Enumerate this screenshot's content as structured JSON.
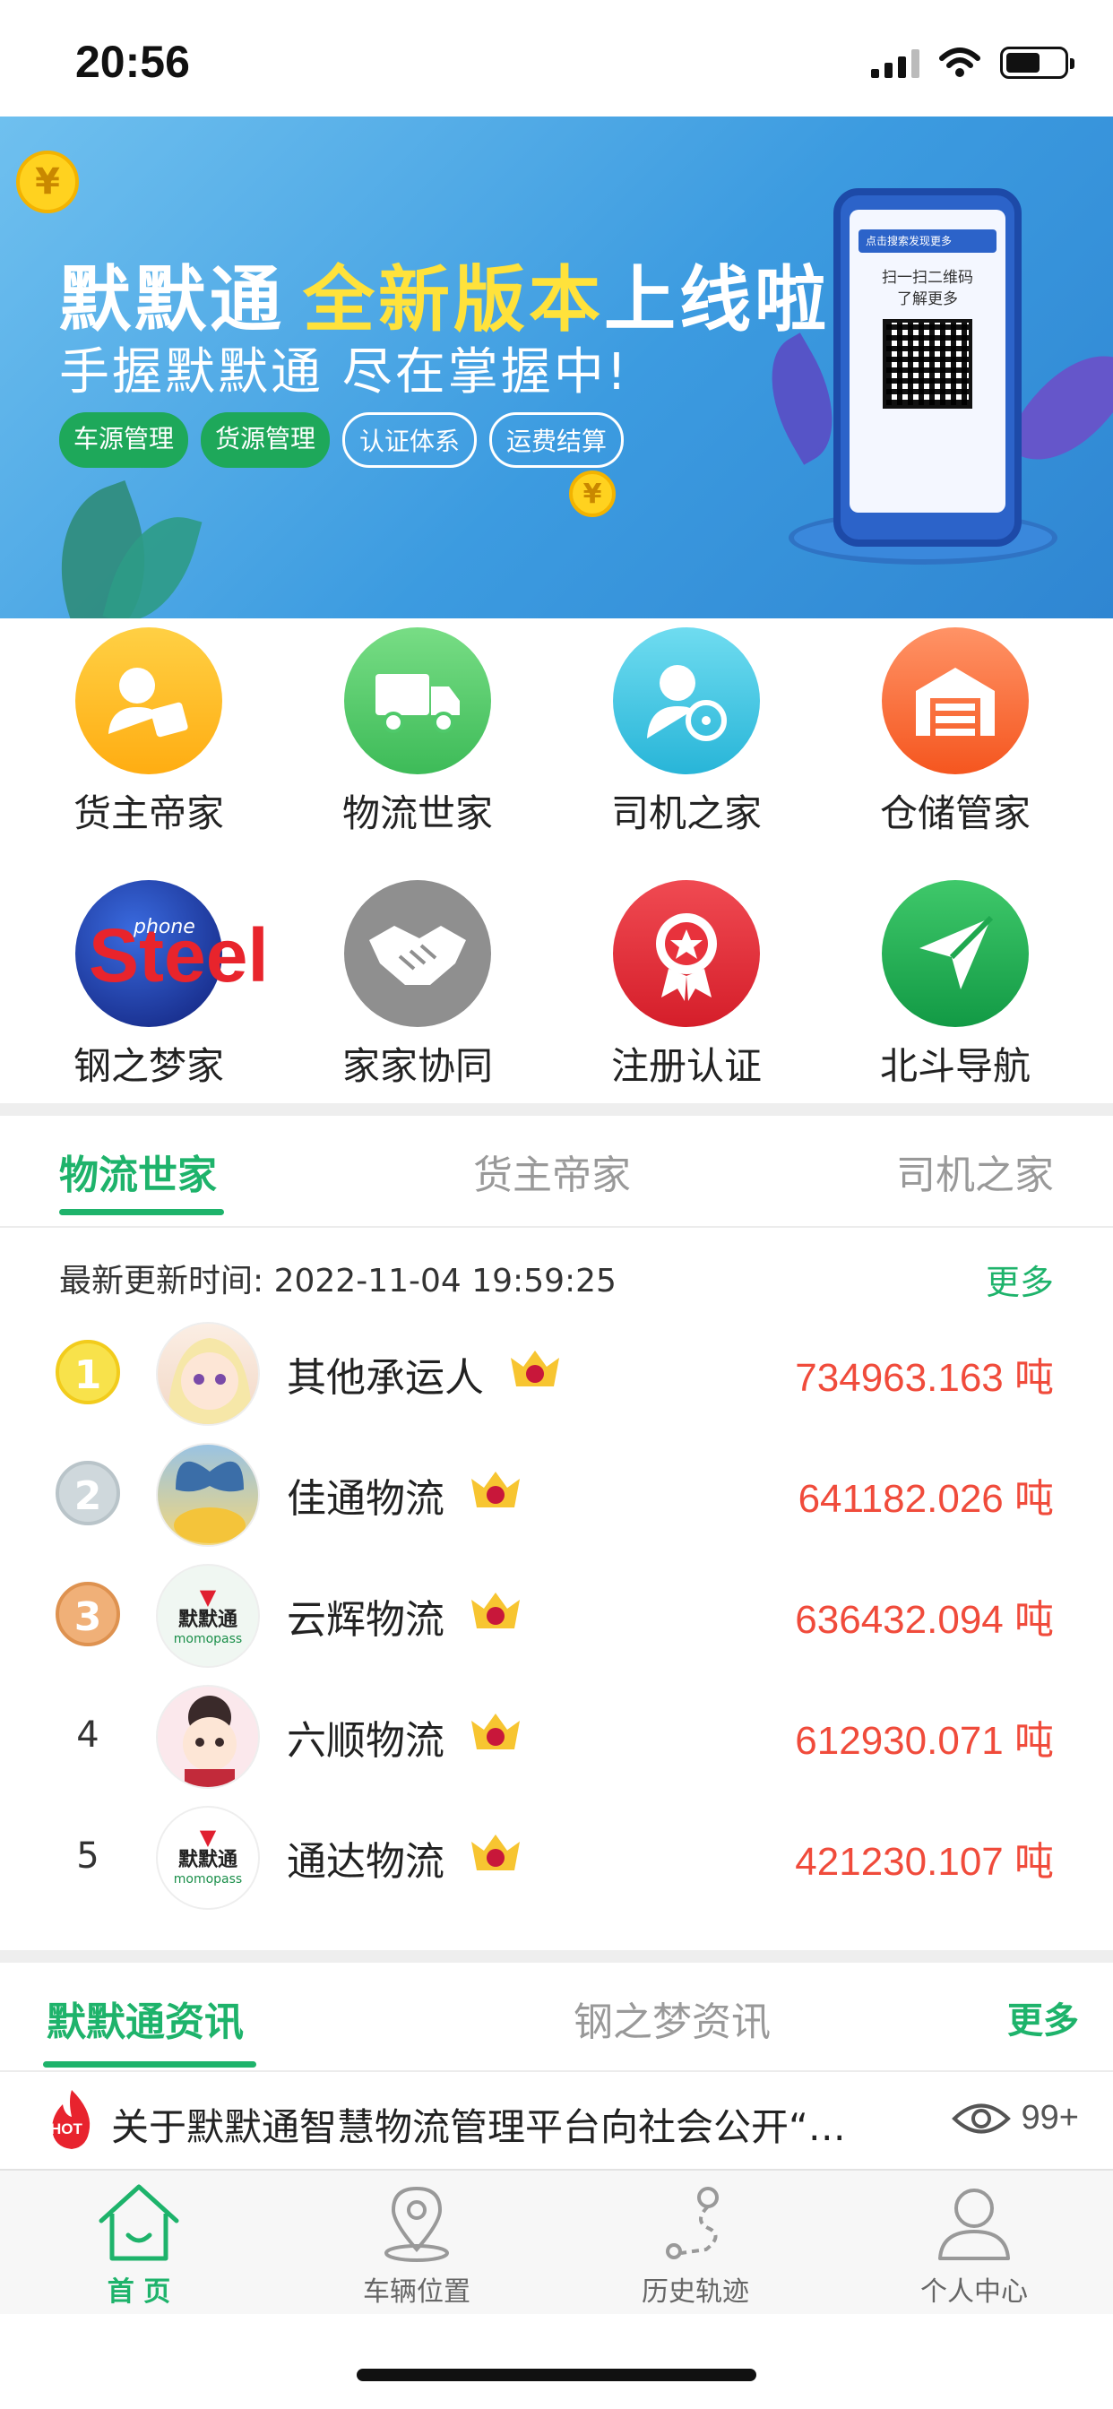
{
  "status_bar": {
    "time": "20:56"
  },
  "banner": {
    "title_main": "默默通",
    "title_highlight": "全新版本",
    "title_tail": "上线啦!",
    "subtitle": "手握默默通 尽在掌握中!",
    "tags": [
      "车源管理",
      "货源管理",
      "认证体系",
      "运费结算"
    ],
    "phone_header": "点击搜索发现更多",
    "phone_text_1": "扫一扫二维码",
    "phone_text_2": "了解更多",
    "coin_symbol": "¥"
  },
  "grid": {
    "items": [
      {
        "label": "货主帝家",
        "icon": "shipper-icon",
        "color": "#ffb21c"
      },
      {
        "label": "物流世家",
        "icon": "truck-icon",
        "color": "#4fc96a"
      },
      {
        "label": "司机之家",
        "icon": "driver-icon",
        "color": "#3fc6e0"
      },
      {
        "label": "仓储管家",
        "icon": "warehouse-icon",
        "color": "#f96a3b"
      },
      {
        "label": "钢之梦家",
        "icon": "steel-logo-icon",
        "color": "#1a3aa5"
      },
      {
        "label": "家家协同",
        "icon": "handshake-icon",
        "color": "#8c8c8c"
      },
      {
        "label": "注册认证",
        "icon": "certificate-icon",
        "color": "#e8323c"
      },
      {
        "label": "北斗导航",
        "icon": "navigation-icon",
        "color": "#1fa84f"
      }
    ]
  },
  "ranking": {
    "tabs": [
      "物流世家",
      "货主帝家",
      "司机之家"
    ],
    "update_label": "最新更新时间:",
    "update_time": "2022-11-04 19:59:25",
    "more": "更多",
    "unit": "吨",
    "rows": [
      {
        "rank": "1",
        "name": "其他承运人",
        "value": "734963.163",
        "avatar": "anime-girl-avatar"
      },
      {
        "rank": "2",
        "name": "佳通物流",
        "value": "641182.026",
        "avatar": "butterfly-avatar"
      },
      {
        "rank": "3",
        "name": "云辉物流",
        "value": "636432.094",
        "avatar": "momopass-logo-avatar"
      },
      {
        "rank": "4",
        "name": "六顺物流",
        "value": "612930.071",
        "avatar": "cartoon-girl-avatar"
      },
      {
        "rank": "5",
        "name": "通达物流",
        "value": "421230.107",
        "avatar": "momopass-logo-avatar"
      }
    ]
  },
  "news": {
    "tabs": [
      "默默通资讯",
      "钢之梦资讯"
    ],
    "more": "更多",
    "item_title": "关于默默通智慧物流管理平台向社会公开“…",
    "hot_label": "HOT",
    "views": "99+"
  },
  "logo_text": {
    "main": "默默通",
    "sub": "momopass",
    "steel": "Steel",
    "phone": "phone"
  },
  "tab_bar": {
    "items": [
      {
        "label": "首 页",
        "icon": "home-icon"
      },
      {
        "label": "车辆位置",
        "icon": "location-icon"
      },
      {
        "label": "历史轨迹",
        "icon": "route-icon"
      },
      {
        "label": "个人中心",
        "icon": "user-icon"
      }
    ]
  },
  "colors": {
    "accent": "#1eb36b",
    "value_red": "#f04b3b"
  }
}
